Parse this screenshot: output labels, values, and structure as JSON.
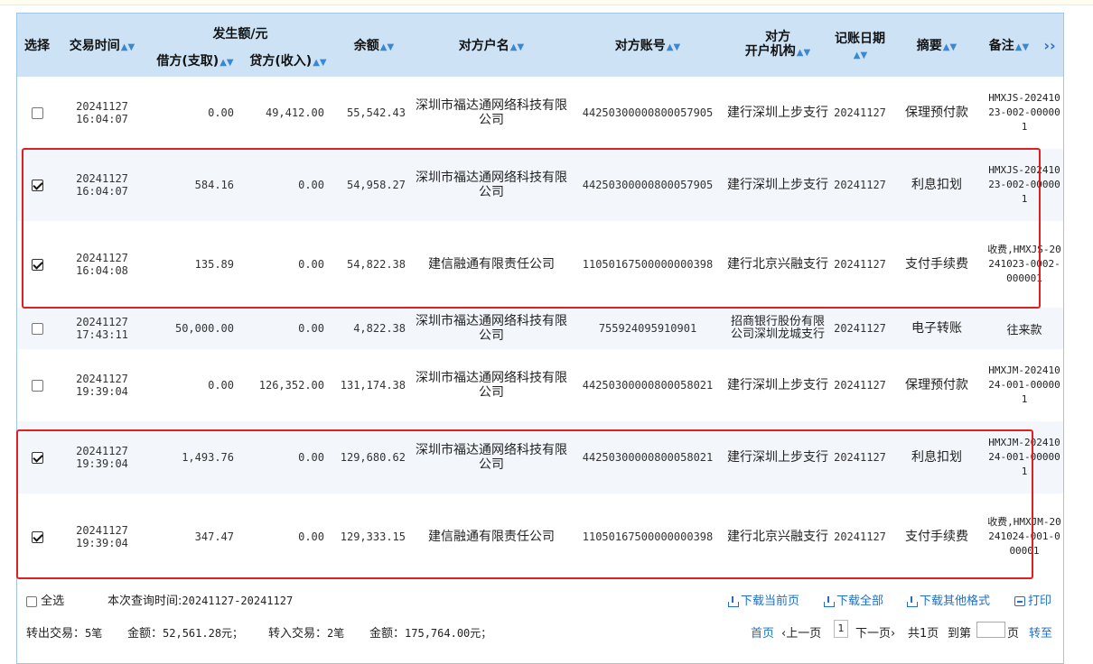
{
  "header": {
    "select": "选择",
    "time": "交易时间",
    "amount_group": "发生额/元",
    "debit": "借方(支取)",
    "credit": "贷方(收入)",
    "balance": "余额",
    "counterparty_name": "对方户名",
    "counterparty_account": "对方账号",
    "counterparty_bank": "对方\n开户机构",
    "posting_date": "记账日期",
    "summary": "摘要",
    "remark": "备注",
    "more": "››"
  },
  "rows": [
    {
      "checked": false,
      "date": "20241127",
      "time": "16:04:07",
      "debit": "0.00",
      "credit": "49,412.00",
      "balance": "55,542.43",
      "name": "深圳市福达通网络科技有限公司",
      "account": "44250300000800057905",
      "bank": "建行深圳上步支行",
      "post_date": "20241127",
      "summary": "保理预付款",
      "remark": "HMXJS-20241023-002-000001"
    },
    {
      "checked": true,
      "date": "20241127",
      "time": "16:04:07",
      "debit": "584.16",
      "credit": "0.00",
      "balance": "54,958.27",
      "name": "深圳市福达通网络科技有限公司",
      "account": "44250300000800057905",
      "bank": "建行深圳上步支行",
      "post_date": "20241127",
      "summary": "利息扣划",
      "remark": "HMXJS-20241023-002-000001"
    },
    {
      "checked": true,
      "date": "20241127",
      "time": "16:04:08",
      "debit": "135.89",
      "credit": "0.00",
      "balance": "54,822.38",
      "name": "建信融通有限责任公司",
      "account": "11050167500000000398",
      "bank": "建行北京兴融支行",
      "post_date": "20241127",
      "summary": "支付手续费",
      "remark": "收费,HMXJS-20241023-0002-000001"
    },
    {
      "checked": false,
      "date": "20241127",
      "time": "17:43:11",
      "debit": "50,000.00",
      "credit": "0.00",
      "balance": "4,822.38",
      "name": "深圳市福达通网络科技有限公司",
      "account": "755924095910901",
      "bank": "招商银行股份有限公司深圳龙城支行",
      "post_date": "20241127",
      "summary": "电子转账",
      "remark": "往来款"
    },
    {
      "checked": false,
      "date": "20241127",
      "time": "19:39:04",
      "debit": "0.00",
      "credit": "126,352.00",
      "balance": "131,174.38",
      "name": "深圳市福达通网络科技有限公司",
      "account": "44250300000800058021",
      "bank": "建行深圳上步支行",
      "post_date": "20241127",
      "summary": "保理预付款",
      "remark": "HMXJM-20241024-001-000001"
    },
    {
      "checked": true,
      "date": "20241127",
      "time": "19:39:04",
      "debit": "1,493.76",
      "credit": "0.00",
      "balance": "129,680.62",
      "name": "深圳市福达通网络科技有限公司",
      "account": "44250300000800058021",
      "bank": "建行深圳上步支行",
      "post_date": "20241127",
      "summary": "利息扣划",
      "remark": "HMXJM-20241024-001-000001"
    },
    {
      "checked": true,
      "date": "20241127",
      "time": "19:39:04",
      "debit": "347.47",
      "credit": "0.00",
      "balance": "129,333.15",
      "name": "建信融通有限责任公司",
      "account": "11050167500000000398",
      "bank": "建行北京兴融支行",
      "post_date": "20241127",
      "summary": "支付手续费",
      "remark": "收费,HMXJM-20241024-001-000001"
    }
  ],
  "footer": {
    "select_all": "全选",
    "query_time_label": "本次查询时间:",
    "query_time_value": "20241127-20241127",
    "download_page": "下载当前页",
    "download_all": "下载全部",
    "download_other": "下载其他格式",
    "print": "打印",
    "out_label": "转出交易：",
    "out_count": "5笔",
    "out_amount_label": "金额：",
    "out_amount": "52,561.28元；",
    "in_label": "转入交易：",
    "in_count": "2笔",
    "in_amount_label": "金额：",
    "in_amount": "175,764.00元；",
    "first": "首页",
    "prev": "‹上一页",
    "page": "1",
    "next": "下一页›",
    "total": "共1页",
    "goto": "到第",
    "page_unit": "页",
    "go": "转至"
  },
  "colors": {
    "header_bg": "#cde3f5",
    "link": "#1f6fc8",
    "highlight_box": "#e02020"
  }
}
